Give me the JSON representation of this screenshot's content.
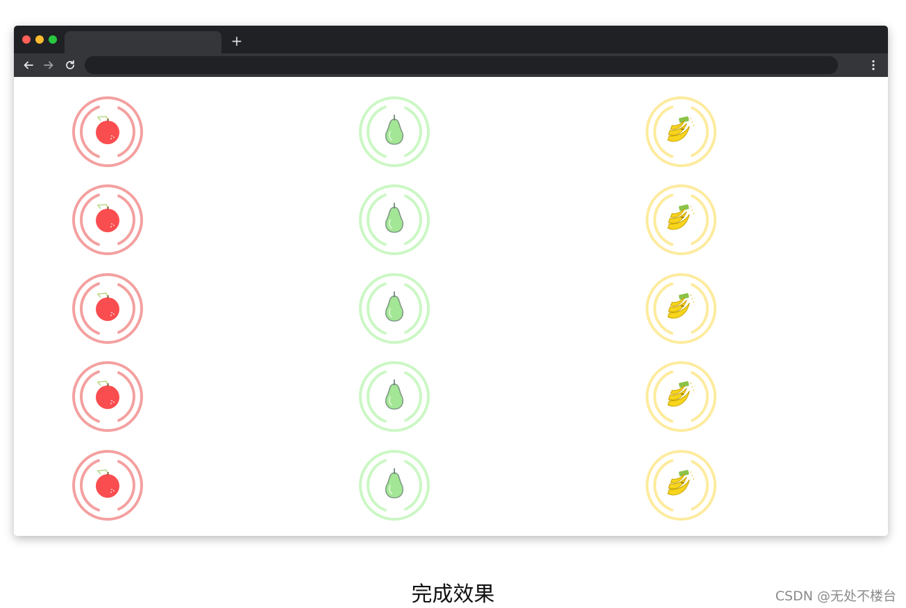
{
  "colors": {
    "window_dot_red": "#ff5f57",
    "window_dot_yellow": "#febc2e",
    "window_dot_green": "#28c840",
    "apple_ring": "#f4a0a0",
    "pear_ring": "#cbf7c4",
    "banana_ring": "#fdeb9e",
    "apple_body": "#fa4d4f",
    "pear_body": "#a3e695",
    "banana_body": "#f7d51d"
  },
  "browser": {
    "new_tab_label": "+",
    "icons": [
      "back-arrow-icon",
      "forward-arrow-icon",
      "reload-icon",
      "menu-dots-icon"
    ]
  },
  "grid": {
    "columns": [
      "apple",
      "pear",
      "banana"
    ],
    "rows": 5
  },
  "caption": "完成效果",
  "watermark": "CSDN @无处不楼台"
}
